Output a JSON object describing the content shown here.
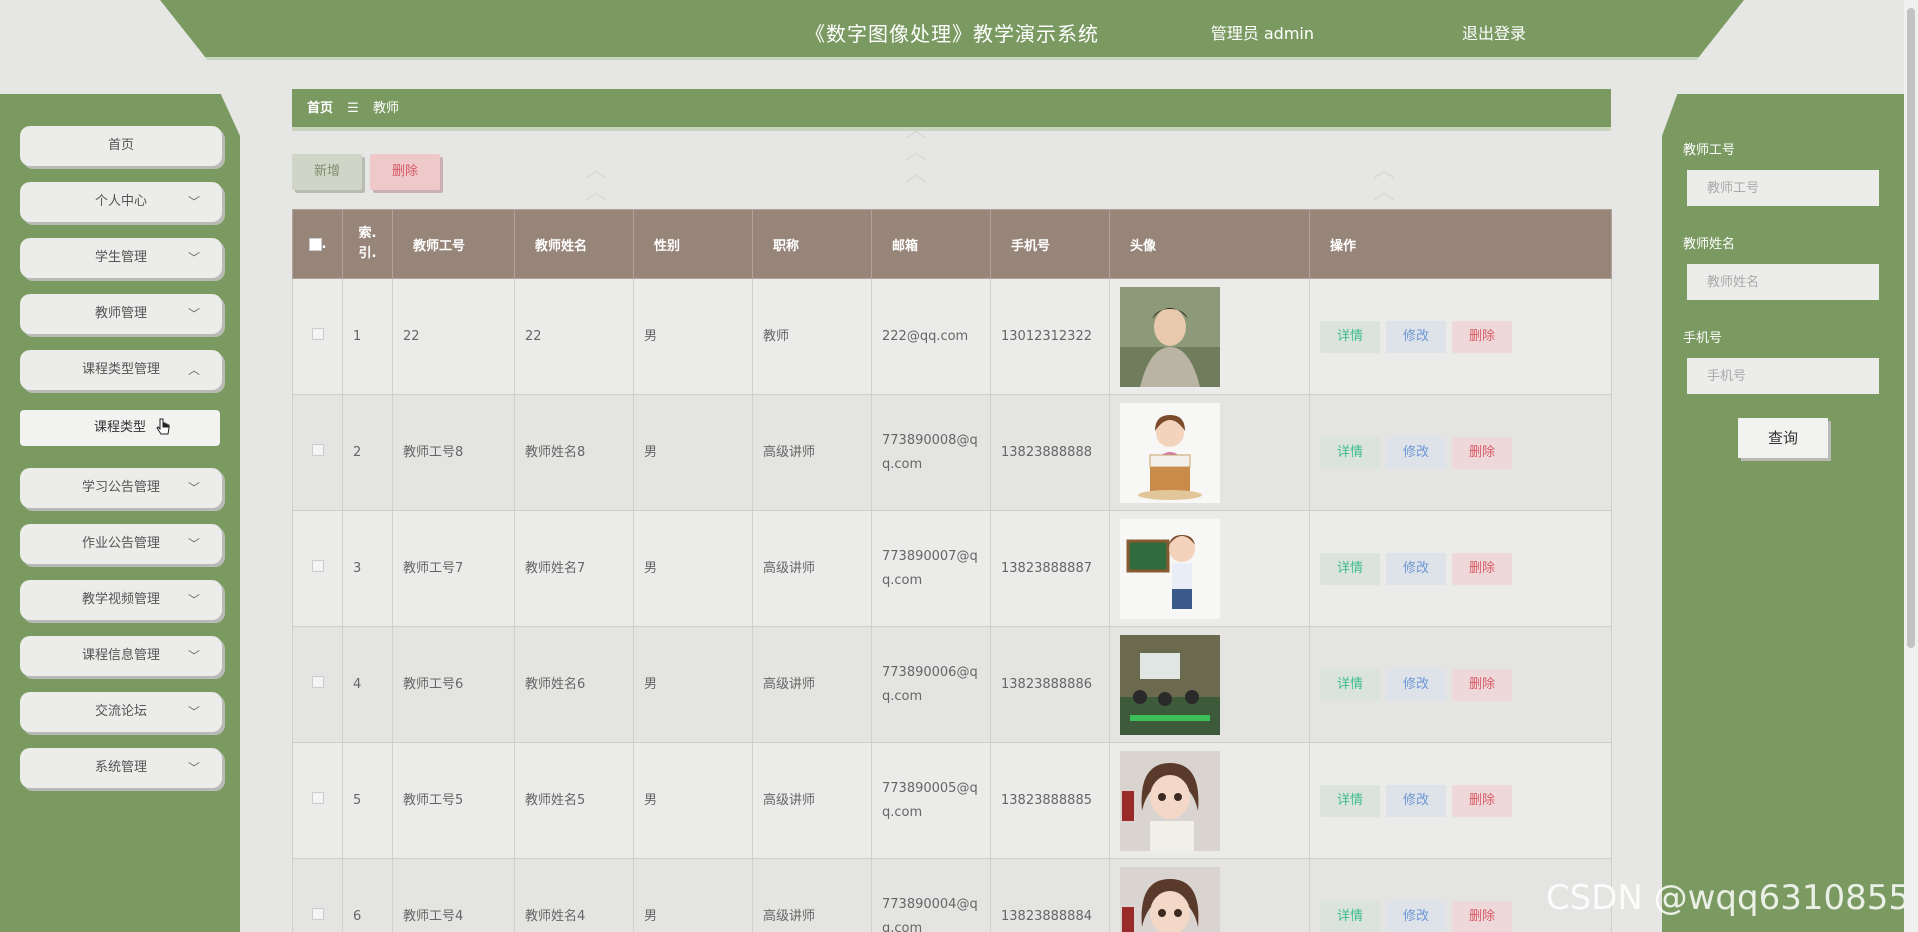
{
  "header": {
    "title": "《数字图像处理》教学演示系统",
    "user": "管理员 admin",
    "logout": "退出登录"
  },
  "sidebar": {
    "items": [
      {
        "label": "首页"
      },
      {
        "label": "个人中心"
      },
      {
        "label": "学生管理"
      },
      {
        "label": "教师管理"
      },
      {
        "label": "课程类型管理"
      },
      {
        "label": "学习公告管理"
      },
      {
        "label": "作业公告管理"
      },
      {
        "label": "教学视频管理"
      },
      {
        "label": "课程信息管理"
      },
      {
        "label": "交流论坛"
      },
      {
        "label": "系统管理"
      }
    ],
    "subitem": "课程类型"
  },
  "breadcrumb": {
    "home": "首页",
    "separator": "☰",
    "current": "教师"
  },
  "toolbar": {
    "add": "新增",
    "delete": "删除"
  },
  "table": {
    "headers": [
      "索引",
      "教师工号",
      "教师姓名",
      "性别",
      "职称",
      "邮箱",
      "手机号",
      "头像",
      "操作"
    ],
    "index_header_line1": "索.",
    "index_header_line2": "引.",
    "rows": [
      {
        "index": "1",
        "no": "22",
        "name": "22",
        "gender": "男",
        "title": "教师",
        "email": "222@qq.com",
        "phone": "13012312322",
        "avatar": "photo-boy"
      },
      {
        "index": "2",
        "no": "教师工号8",
        "name": "教师姓名8",
        "gender": "男",
        "title": "高级讲师",
        "email": "773890008@qq.com",
        "phone": "13823888888",
        "avatar": "cartoon-reader"
      },
      {
        "index": "3",
        "no": "教师工号7",
        "name": "教师姓名7",
        "gender": "男",
        "title": "高级讲师",
        "email": "773890007@qq.com",
        "phone": "13823888887",
        "avatar": "cartoon-teacher"
      },
      {
        "index": "4",
        "no": "教师工号6",
        "name": "教师姓名6",
        "gender": "男",
        "title": "高级讲师",
        "email": "773890006@qq.com",
        "phone": "13823888886",
        "avatar": "photo-classroom"
      },
      {
        "index": "5",
        "no": "教师工号5",
        "name": "教师姓名5",
        "gender": "男",
        "title": "高级讲师",
        "email": "773890005@qq.com",
        "phone": "13823888885",
        "avatar": "cartoon-girl"
      },
      {
        "index": "6",
        "no": "教师工号4",
        "name": "教师姓名4",
        "gender": "男",
        "title": "高级讲师",
        "email": "773890004@qq.com",
        "phone": "13823888884",
        "avatar": "cartoon-girl"
      }
    ],
    "actions": {
      "detail": "详情",
      "edit": "修改",
      "delete": "删除"
    }
  },
  "search": {
    "teacher_no_label": "教师工号",
    "teacher_no_placeholder": "教师工号",
    "teacher_name_label": "教师姓名",
    "teacher_name_placeholder": "教师姓名",
    "phone_label": "手机号",
    "phone_placeholder": "手机号",
    "query": "查询"
  },
  "watermark": "CSDN @wqq6310855",
  "colors": {
    "primary_green": "#7a9a62",
    "table_header": "#978579",
    "detail": "#3fbc90",
    "edit": "#6d96d2",
    "danger": "#d65b66"
  }
}
